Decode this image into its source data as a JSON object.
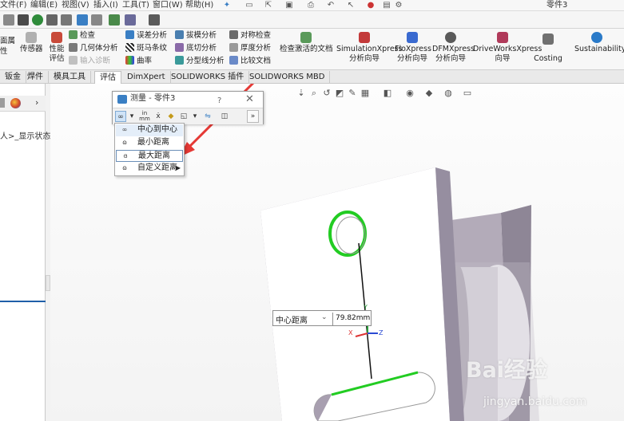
{
  "menubar": {
    "items": [
      "文件(F)",
      "编辑(E)",
      "视图(V)",
      "插入(I)",
      "工具(T)",
      "窗口(W)",
      "帮助(H)"
    ],
    "document_title": "零件3"
  },
  "ribbon": {
    "left_partial": [
      "面属",
      "性"
    ],
    "sensor": "传感器",
    "perf_eval_line1": "性能",
    "perf_eval_line2": "评估",
    "check": "检查",
    "geometry_analysis": "几何体分析",
    "import_diagnostics": "输入诊断",
    "deviation_analysis": "误差分析",
    "zebra_stripes": "斑马条纹",
    "curvature": "曲率",
    "draft_analysis": "拔模分析",
    "undercut_analysis": "底切分析",
    "parting_line_analysis": "分型线分析",
    "symmetry_check": "对称检查",
    "thickness_analysis": "厚度分析",
    "compare_documents": "比较文档",
    "check_active_document": "检查激活的文档",
    "simulationxpress_line1": "SimulationXpress",
    "simulationxpress_line2": "分析向导",
    "floxpress_line1": "FloXpress",
    "floxpress_line2": "分析向导",
    "dfmxpress_line1": "DFMXpress",
    "dfmxpress_line2": "分析向导",
    "driveworksxpress_line1": "DriveWorksXpress",
    "driveworksxpress_line2": "向导",
    "costing": "Costing",
    "sustainability": "Sustainability"
  },
  "tabs": [
    "钣金",
    "焊件",
    "模具工具",
    "评估",
    "DimXpert",
    "SOLIDWORKS 插件",
    "SOLIDWORKS MBD"
  ],
  "active_tab": "评估",
  "left_panel": {
    "tree_text": "人>_显示状态"
  },
  "measure_dialog": {
    "title": "测量 - 零件3",
    "help": "?",
    "close": "✕",
    "units_line1": "in",
    "units_line2": "mm"
  },
  "dropdown": {
    "items": [
      "中心到中心",
      "最小距离",
      "最大距离",
      "自定义距离"
    ],
    "highlighted": "最大距离"
  },
  "measurement_label": {
    "mode": "中心距离",
    "value": "79.82mm"
  },
  "axes": {
    "x": "X",
    "y": "Y",
    "z": "Z"
  },
  "watermark": {
    "brand": "Bai经验",
    "url": "jingyan.baidu.com"
  },
  "colors": {
    "accent_blue": "#1f5fa8",
    "highlight_green": "#22cc22",
    "annotation_red": "#e53935",
    "part_side": "#9c93a3",
    "part_face": "#ffffff"
  }
}
